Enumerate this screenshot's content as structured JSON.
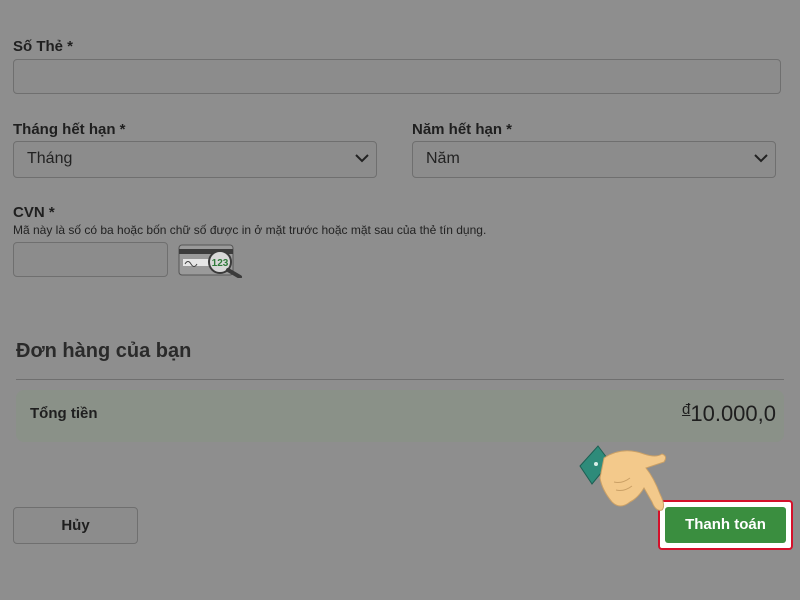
{
  "form": {
    "card_number": {
      "label": "Số Thẻ *",
      "value": ""
    },
    "expiry_month": {
      "label": "Tháng hết hạn *",
      "selected": "Tháng"
    },
    "expiry_year": {
      "label": "Năm hết hạn *",
      "selected": "Năm"
    },
    "cvn": {
      "label": "CVN *",
      "hint": "Mã này là số có ba hoặc bốn chữ số được in ở mặt trước hoặc mặt sau của thẻ tín dụng.",
      "value": "",
      "icon_text": "123"
    }
  },
  "order": {
    "title": "Đơn hàng của bạn",
    "total_label": "Tổng tiền",
    "currency_symbol": "đ",
    "total_value": "10.000,0"
  },
  "actions": {
    "cancel_label": "Hủy",
    "pay_label": "Thanh toán"
  },
  "icons": {
    "chevron": "chevron-down-icon",
    "card_cvn": "card-cvn-icon",
    "pointer": "pointing-hand-icon"
  },
  "colors": {
    "overlay_bg": "#8e8e8e",
    "pay_button": "#3a8e3f",
    "highlight_border": "#d4102a",
    "hand_skin": "#f3c98b",
    "hand_sleeve": "#2e8b7a"
  }
}
